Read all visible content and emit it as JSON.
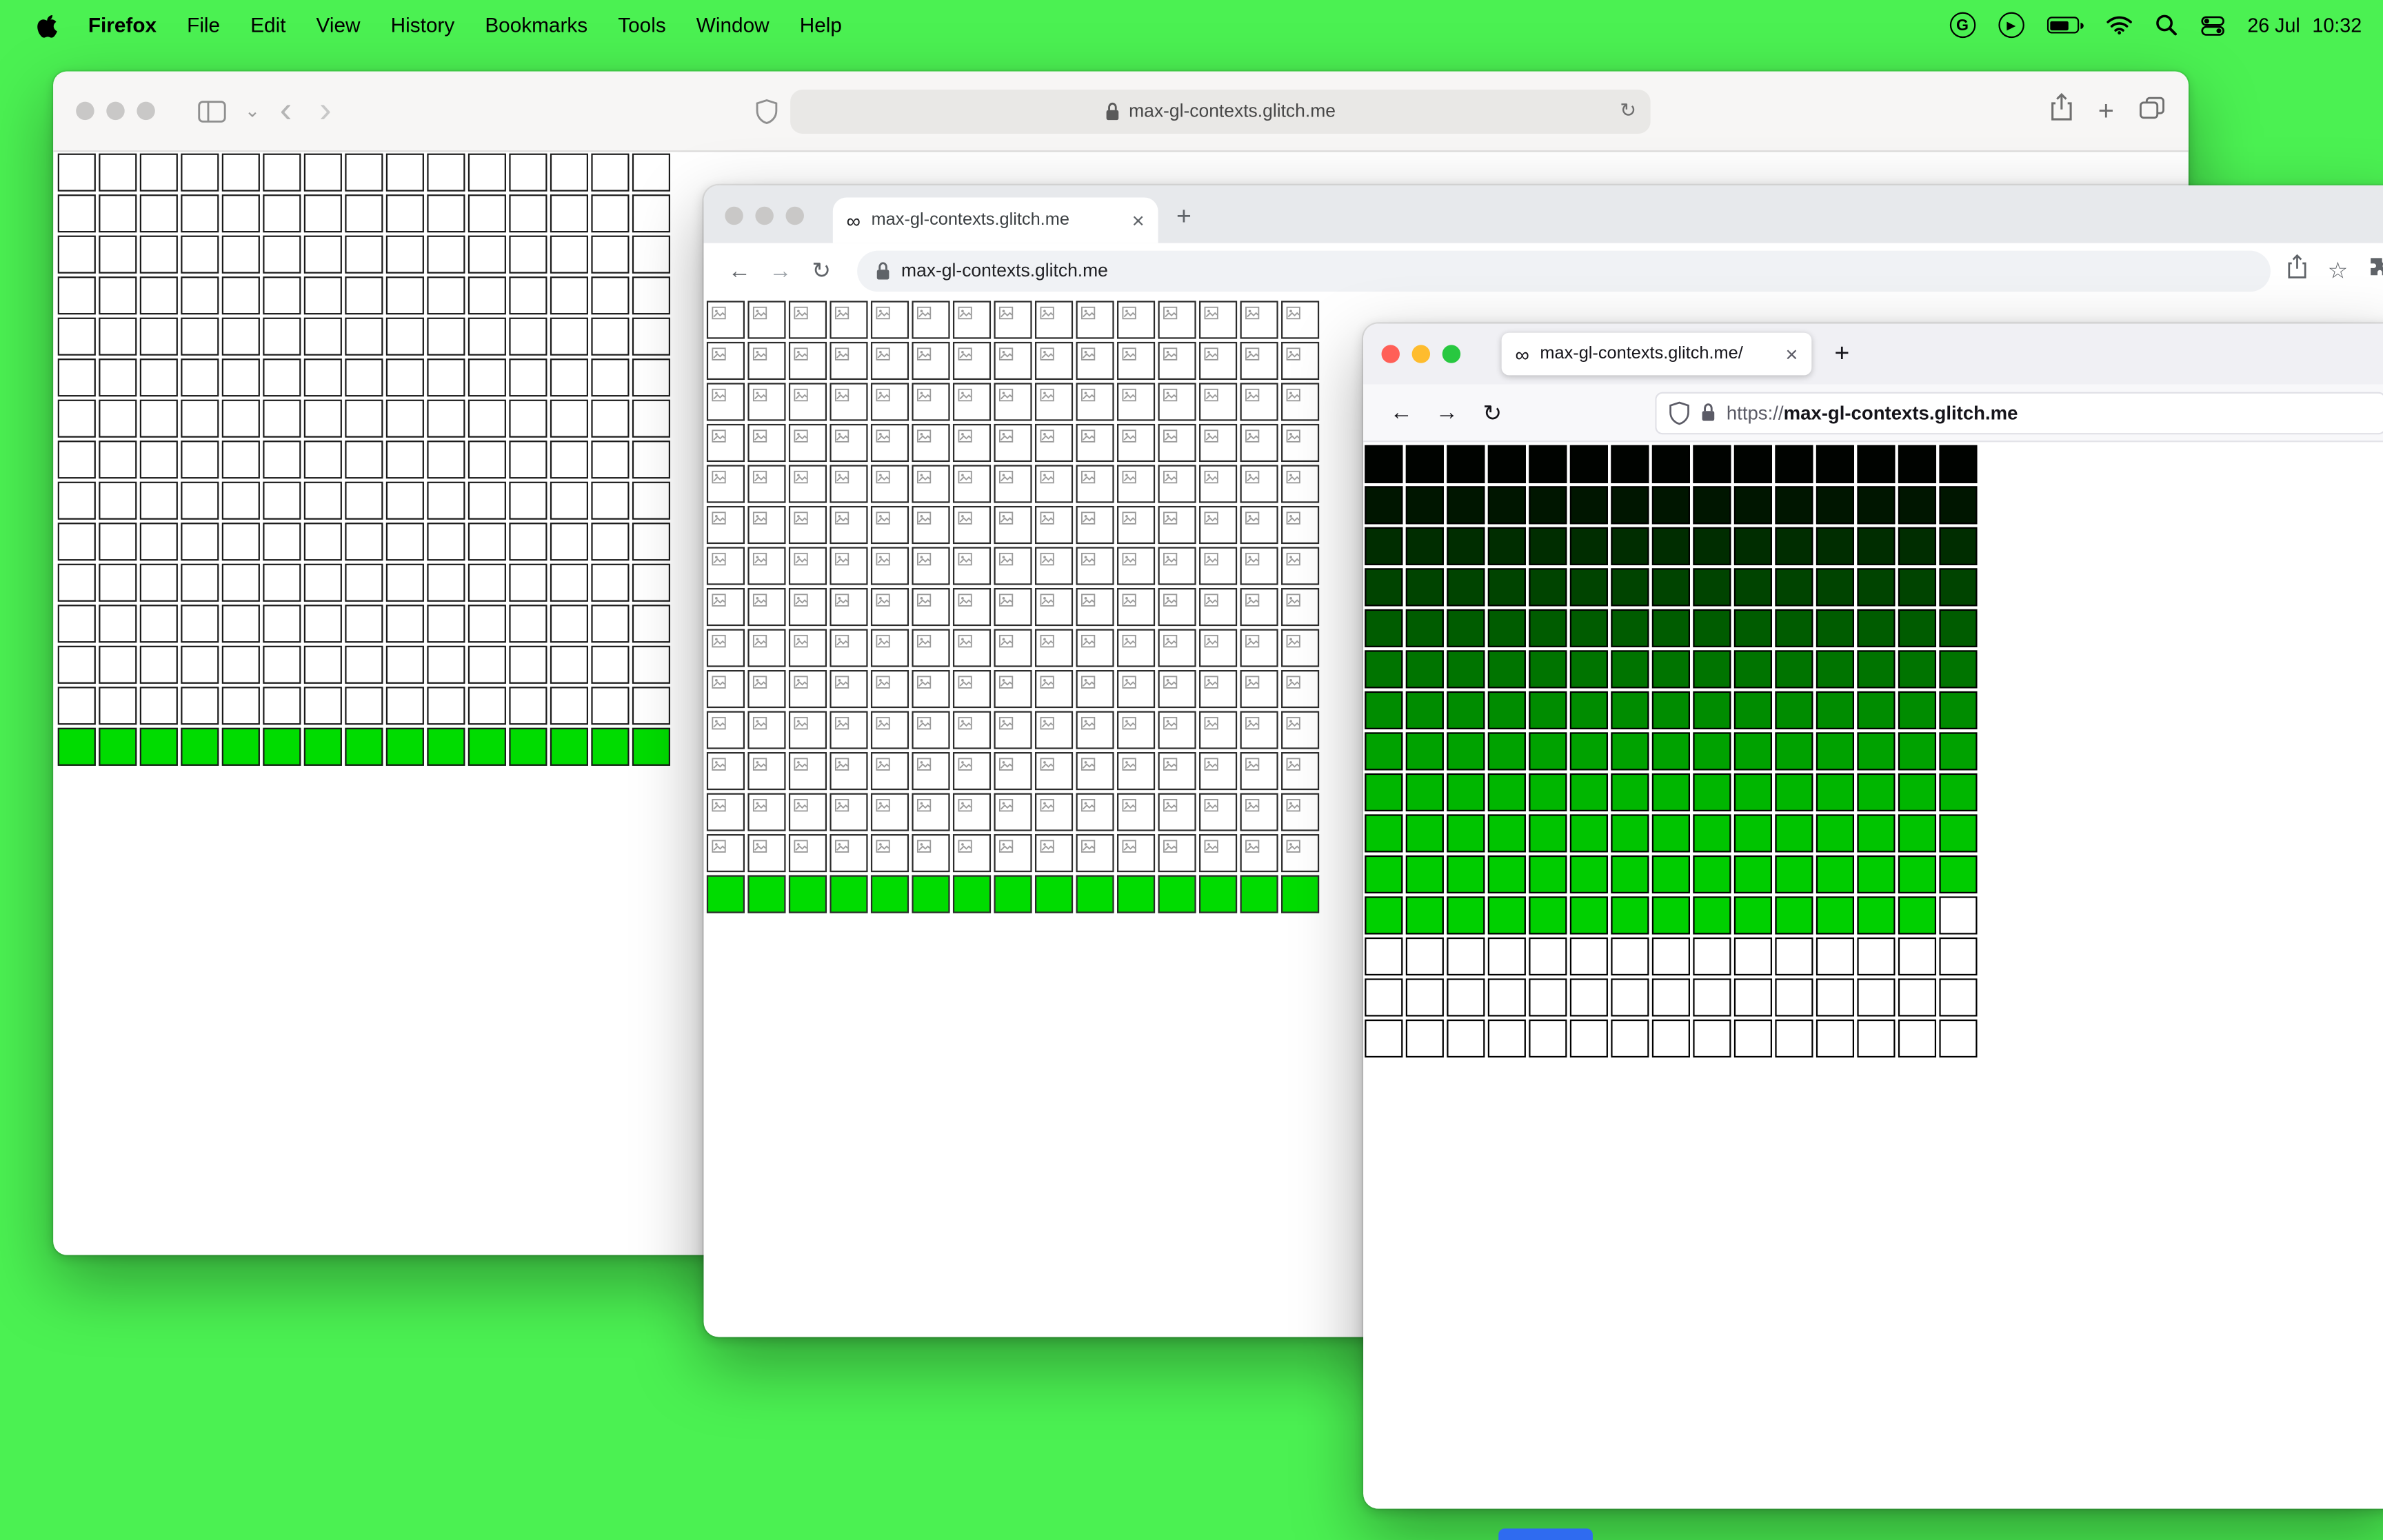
{
  "desktop": {
    "background": "#4bf152",
    "dock_peek_color": "#2f6bf0"
  },
  "menubar": {
    "app_name": "Firefox",
    "menus": [
      "File",
      "Edit",
      "View",
      "History",
      "Bookmarks",
      "Tools",
      "Window",
      "Help"
    ],
    "date": "26 Jul",
    "time": "10:32"
  },
  "icons": {
    "grammarly": "G",
    "play": "▶",
    "infinity": "∞",
    "close": "×",
    "plus": "+",
    "back": "←",
    "forward": "→",
    "reload": "↻",
    "star": "☆",
    "chevron_down": "⌄",
    "chevron_back": "‹",
    "chevron_forward": "›"
  },
  "safari_window": {
    "url": "max-gl-contexts.glitch.me",
    "grid": {
      "cols": 15,
      "rows": 15,
      "default_color": "#ffffff",
      "border_color": "#1a1a1a",
      "row_colors": {
        "14": "#00dc00"
      }
    }
  },
  "chrome_window": {
    "tab_title": "max-gl-contexts.glitch.me",
    "url": "max-gl-contexts.glitch.me",
    "grid": {
      "cols": 15,
      "rows": 15,
      "default_color": "#ffffff",
      "border_color": "#2b2b2b",
      "broken_image_icon": true,
      "row_colors": {
        "14": "#00dc00"
      }
    }
  },
  "firefox_window": {
    "tab_title": "max-gl-contexts.glitch.me/",
    "url_scheme": "https://",
    "url_host": "max-gl-contexts.glitch.me",
    "grid": {
      "cols": 15,
      "rows": 15,
      "default_color": "#ffffff",
      "border_color": "#000000",
      "row_colors": {
        "0": "#000300",
        "1": "#001600",
        "2": "#002d00",
        "3": "#004400",
        "4": "#005c00",
        "5": "#007400",
        "6": "#008c00",
        "7": "#00a200",
        "8": "#00b600",
        "9": "#00c400",
        "10": "#00cc00",
        "11": "#00d000"
      },
      "overrides": [
        {
          "row": 11,
          "col": 14,
          "color": "#ffffff"
        }
      ]
    }
  }
}
